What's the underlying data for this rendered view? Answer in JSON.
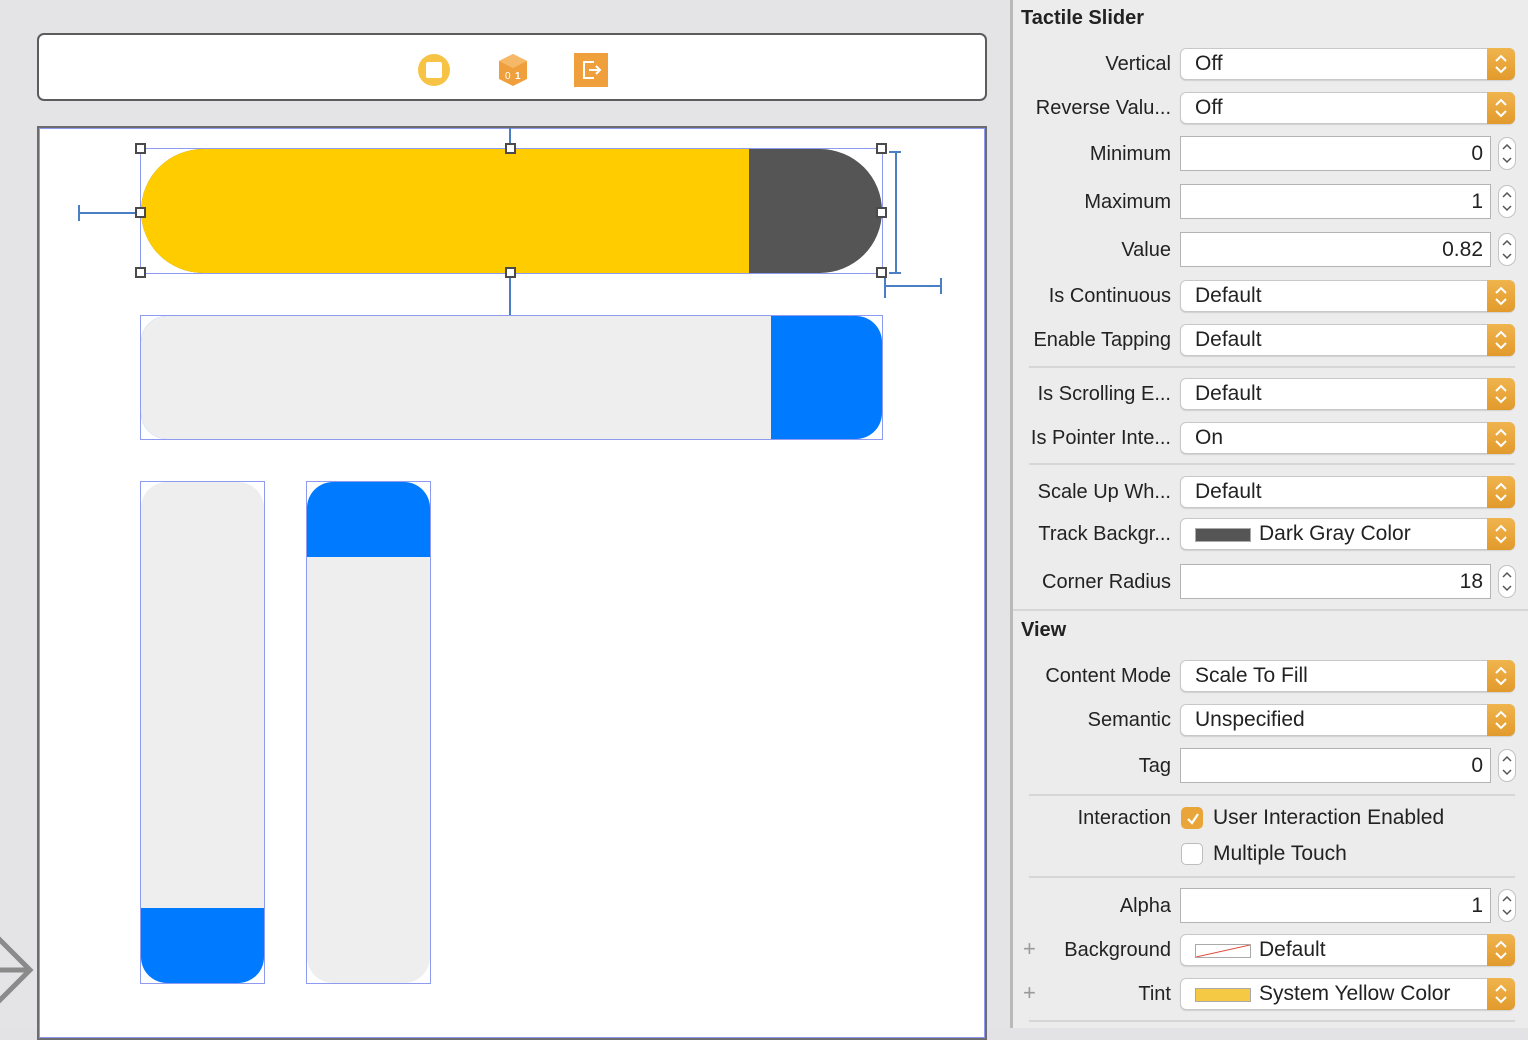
{
  "canvas": {
    "dock_icons": [
      {
        "name": "view-controller-icon",
        "color": "#f6c344"
      },
      {
        "name": "first-responder-icon",
        "color": "#ef9f3c"
      },
      {
        "name": "exit-icon",
        "color": "#ef9f3c"
      }
    ],
    "sliders": [
      {
        "id": "horizontal-slider-selected",
        "orientation": "horizontal",
        "value": 0.82,
        "fill_color": "#ffcc00",
        "track_color": "#555555",
        "shape": "capsule",
        "selected": true
      },
      {
        "id": "horizontal-slider-2",
        "orientation": "horizontal",
        "value": 0.85,
        "fill_color": "#eeeeee",
        "track_color": "#007aff",
        "shape": "rounded"
      },
      {
        "id": "vertical-slider-1",
        "orientation": "vertical",
        "value": 0.15,
        "fill_color": "#007aff",
        "track_color": "#eeeeee",
        "fill_from": "bottom"
      },
      {
        "id": "vertical-slider-2",
        "orientation": "vertical",
        "value": 0.15,
        "fill_color": "#007aff",
        "track_color": "#eeeeee",
        "fill_from": "top"
      }
    ]
  },
  "inspector": {
    "tactile_section": {
      "title": "Tactile Slider",
      "vertical": {
        "label": "Vertical",
        "value": "Off"
      },
      "reverse_values": {
        "label": "Reverse Valu...",
        "value": "Off"
      },
      "minimum": {
        "label": "Minimum",
        "value": "0"
      },
      "maximum": {
        "label": "Maximum",
        "value": "1"
      },
      "value": {
        "label": "Value",
        "value": "0.82"
      },
      "is_continuous": {
        "label": "Is Continuous",
        "value": "Default"
      },
      "enable_tapping": {
        "label": "Enable Tapping",
        "value": "Default"
      },
      "is_scrolling": {
        "label": "Is Scrolling E...",
        "value": "Default"
      },
      "is_pointer": {
        "label": "Is Pointer Inte...",
        "value": "On"
      },
      "scale_up": {
        "label": "Scale Up Wh...",
        "value": "Default"
      },
      "track_background": {
        "label": "Track Backgr...",
        "value": "Dark Gray Color",
        "swatch": "#555555"
      },
      "corner_radius": {
        "label": "Corner Radius",
        "value": "18"
      }
    },
    "view_section": {
      "title": "View",
      "content_mode": {
        "label": "Content Mode",
        "value": "Scale To Fill"
      },
      "semantic": {
        "label": "Semantic",
        "value": "Unspecified"
      },
      "tag": {
        "label": "Tag",
        "value": "0"
      },
      "interaction": {
        "label": "Interaction",
        "user_interaction": {
          "label": "User Interaction Enabled",
          "checked": true
        },
        "multiple_touch": {
          "label": "Multiple Touch",
          "checked": false
        }
      },
      "alpha": {
        "label": "Alpha",
        "value": "1"
      },
      "background": {
        "label": "Background",
        "value": "Default"
      },
      "tint": {
        "label": "Tint",
        "value": "System Yellow Color",
        "swatch": "#f6c944"
      }
    },
    "accent_color": "#e9a53a"
  }
}
